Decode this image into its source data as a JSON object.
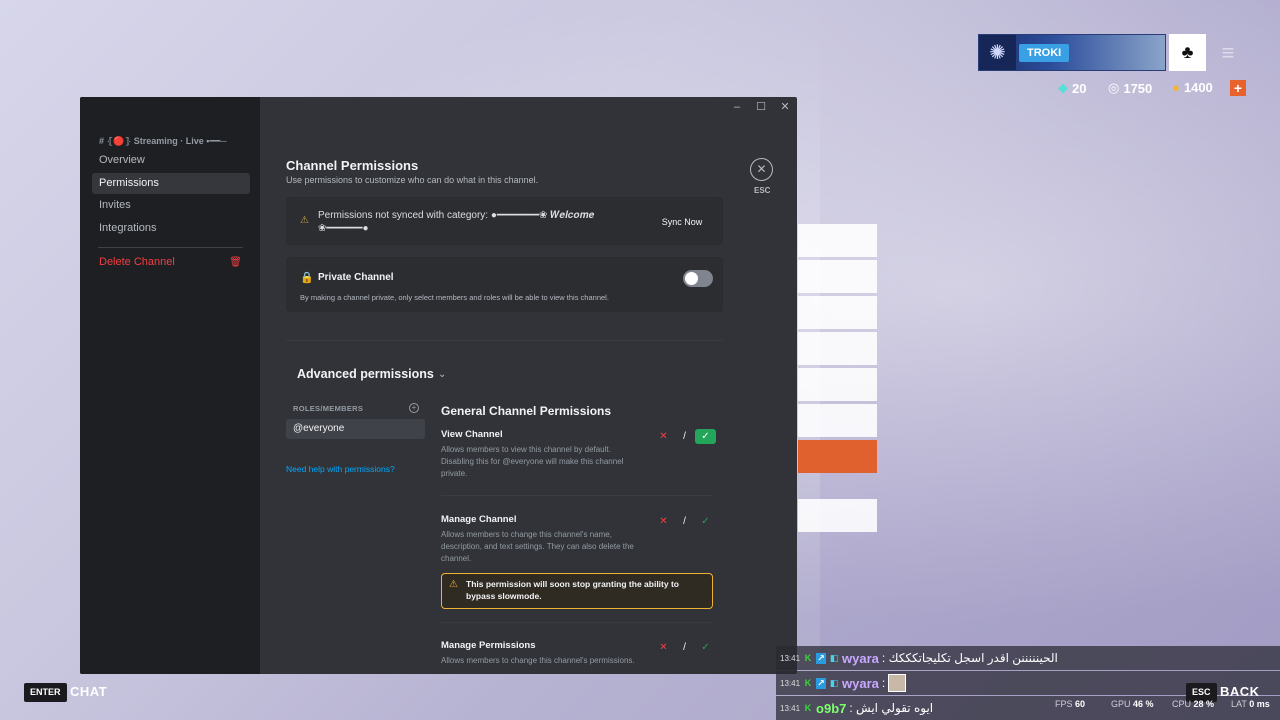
{
  "hud": {
    "player_name": "TROKI",
    "currencies": [
      {
        "icon": "gem-icon",
        "value": "20",
        "color": "#58e0d6"
      },
      {
        "icon": "credit-icon",
        "value": "1750",
        "color": "#ffffff"
      },
      {
        "icon": "coin-icon",
        "value": "1400",
        "color": "#f2b53a"
      }
    ],
    "add_label": "+"
  },
  "window": {
    "controls": [
      "–",
      "☐",
      "✕"
    ],
    "sidebar": {
      "category": "# ⦃🔴⦄ Streaming · Live •━━─",
      "items": [
        {
          "label": "Overview",
          "active": false
        },
        {
          "label": "Permissions",
          "active": true
        },
        {
          "label": "Invites",
          "active": false
        },
        {
          "label": "Integrations",
          "active": false
        }
      ],
      "delete_label": "Delete Channel"
    },
    "header": {
      "title": "Channel Permissions",
      "subtitle": "Use permissions to customize who can do what in this channel.",
      "esc_label": "ESC"
    },
    "sync": {
      "text": "Permissions not synced with category: ●━━━━━━━❀ 𝑾𝒆𝒍𝒄𝒐𝒎𝒆 ❀━━━━━━●",
      "button": "Sync Now"
    },
    "private_channel": {
      "title": "Private Channel",
      "description": "By making a channel private, only select members and roles will be able to view this channel.",
      "enabled": false
    },
    "advanced": {
      "title": "Advanced permissions",
      "roles_label": "ROLES/MEMBERS",
      "roles": [
        "@everyone"
      ],
      "help_link": "Need help with permissions?",
      "section_title": "General Channel Permissions",
      "permissions": [
        {
          "name": "View Channel",
          "description": "Allows members to view this channel by default. Disabling this for @everyone will make this channel private.",
          "state": "allow"
        },
        {
          "name": "Manage Channel",
          "description": "Allows members to change this channel's name, description, and text settings. They can also delete the channel.",
          "state": "neutral",
          "warning": "This permission will soon stop granting the ability to bypass slowmode."
        },
        {
          "name": "Manage Permissions",
          "description": "Allows members to change this channel's permissions.",
          "state": "neutral"
        }
      ]
    }
  },
  "bottom": {
    "enter_key": "ENTER",
    "chat_label": "CHAT",
    "esc_key": "ESC",
    "back_label": "BACK"
  },
  "chat": [
    {
      "time": "13:41",
      "user": "wyara",
      "user_color": "#c9a8ff",
      "message": ": الحينننننن اقدر اسجل تكليجاتكككك"
    },
    {
      "time": "13:41",
      "user": "wyara",
      "user_color": "#c9a8ff",
      "message": ":"
    },
    {
      "time": "13:41",
      "user": "o9b7",
      "user_color": "#7dff6e",
      "message": ": ايوه تقولي ايش"
    }
  ],
  "stats": [
    {
      "label": "FPS",
      "value": "60"
    },
    {
      "label": "GPU",
      "value": "46 %"
    },
    {
      "label": "CPU",
      "value": "28 %"
    },
    {
      "label": "LAT",
      "value": "0 ms"
    }
  ]
}
